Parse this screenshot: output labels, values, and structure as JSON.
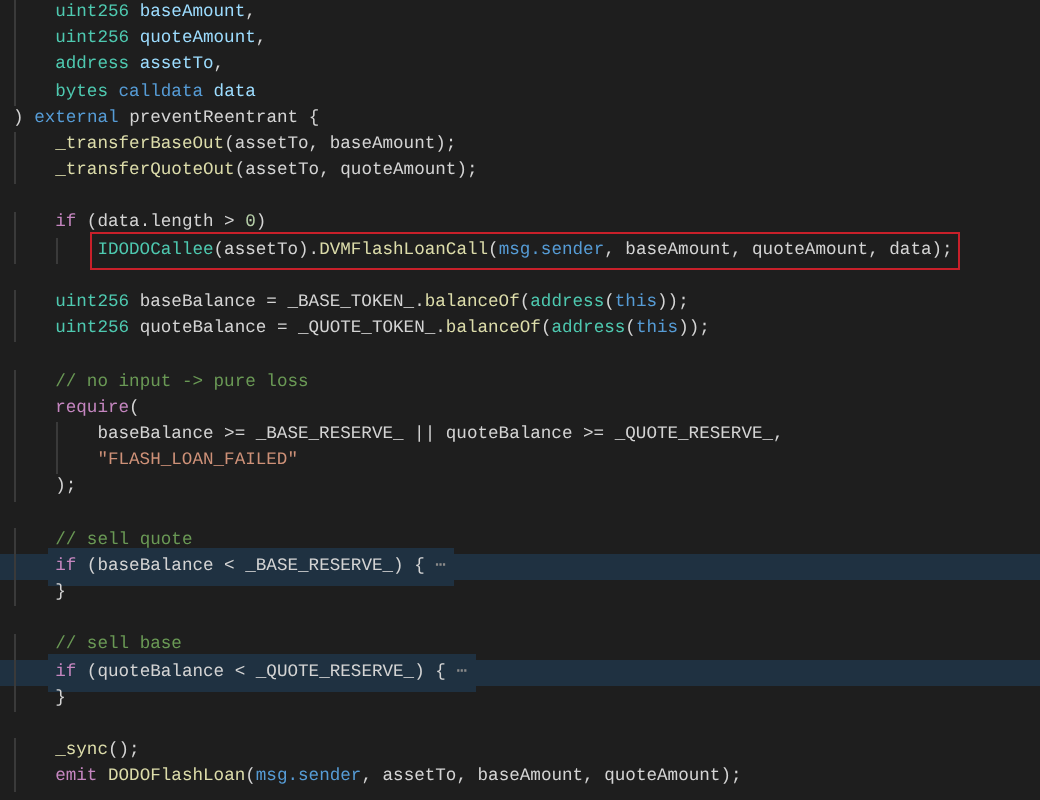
{
  "editor": {
    "lines": [
      {
        "kind": "code",
        "tokens": [
          {
            "text": "    uint256",
            "kind": "type"
          },
          {
            "text": " baseAmount",
            "kind": "var"
          },
          {
            "text": ","
          }
        ],
        "folded": false,
        "boxed": false
      },
      {
        "kind": "code",
        "tokens": [
          {
            "text": "    uint256",
            "kind": "type"
          },
          {
            "text": " quoteAmount",
            "kind": "var"
          },
          {
            "text": ","
          }
        ],
        "folded": false,
        "boxed": false
      },
      {
        "kind": "code",
        "tokens": [
          {
            "text": "    address",
            "kind": "type"
          },
          {
            "text": " assetTo",
            "kind": "var"
          },
          {
            "text": ","
          }
        ],
        "folded": false,
        "boxed": false
      },
      {
        "kind": "code",
        "tokens": [
          {
            "text": "    bytes",
            "kind": "type"
          },
          {
            "text": " calldata",
            "kind": "keyword"
          },
          {
            "text": " data",
            "kind": "var"
          }
        ],
        "folded": false,
        "boxed": false
      },
      {
        "kind": "code",
        "tokens": [
          {
            "text": ") "
          },
          {
            "text": "external",
            "kind": "keyword"
          },
          {
            "text": " preventReentrant {"
          }
        ],
        "folded": false,
        "boxed": false
      },
      {
        "kind": "code",
        "tokens": [
          {
            "text": "    _transferBaseOut",
            "kind": "func"
          },
          {
            "text": "(assetTo, baseAmount);"
          }
        ],
        "folded": false,
        "boxed": false
      },
      {
        "kind": "code",
        "tokens": [
          {
            "text": "    _transferQuoteOut",
            "kind": "func"
          },
          {
            "text": "(assetTo, quoteAmount);"
          }
        ],
        "folded": false,
        "boxed": false
      },
      {
        "kind": "blank"
      },
      {
        "kind": "code",
        "tokens": [
          {
            "text": "    if",
            "kind": "control"
          },
          {
            "text": " (data.length > "
          },
          {
            "text": "0",
            "kind": "number"
          },
          {
            "text": ")"
          }
        ],
        "folded": false,
        "boxed": false
      },
      {
        "kind": "code",
        "tokens": [
          {
            "text": "        IDODOCallee",
            "kind": "type"
          },
          {
            "text": "(assetTo)."
          },
          {
            "text": "DVMFlashLoanCall",
            "kind": "func"
          },
          {
            "text": "("
          },
          {
            "text": "msg.sender",
            "kind": "keyword"
          },
          {
            "text": ", baseAmount, quoteAmount, data);"
          }
        ],
        "folded": false,
        "boxed": true
      },
      {
        "kind": "blank"
      },
      {
        "kind": "code",
        "tokens": [
          {
            "text": "    uint256",
            "kind": "type"
          },
          {
            "text": " baseBalance = _BASE_TOKEN_."
          },
          {
            "text": "balanceOf",
            "kind": "func"
          },
          {
            "text": "("
          },
          {
            "text": "address",
            "kind": "type"
          },
          {
            "text": "("
          },
          {
            "text": "this",
            "kind": "keyword"
          },
          {
            "text": "));"
          }
        ],
        "folded": false,
        "boxed": false
      },
      {
        "kind": "code",
        "tokens": [
          {
            "text": "    uint256",
            "kind": "type"
          },
          {
            "text": " quoteBalance = _QUOTE_TOKEN_."
          },
          {
            "text": "balanceOf",
            "kind": "func"
          },
          {
            "text": "("
          },
          {
            "text": "address",
            "kind": "type"
          },
          {
            "text": "("
          },
          {
            "text": "this",
            "kind": "keyword"
          },
          {
            "text": "));"
          }
        ],
        "folded": false,
        "boxed": false
      },
      {
        "kind": "blank"
      },
      {
        "kind": "code",
        "tokens": [
          {
            "text": "    // no input -> pure loss",
            "kind": "comment"
          }
        ],
        "folded": false,
        "boxed": false
      },
      {
        "kind": "code",
        "tokens": [
          {
            "text": "    require",
            "kind": "control"
          },
          {
            "text": "("
          }
        ],
        "folded": false,
        "boxed": false
      },
      {
        "kind": "code",
        "tokens": [
          {
            "text": "        baseBalance >= _BASE_RESERVE_ || quoteBalance >= _QUOTE_RESERVE_,"
          }
        ],
        "folded": false,
        "boxed": false
      },
      {
        "kind": "code",
        "tokens": [
          {
            "text": "        \"FLASH_LOAN_FAILED\"",
            "kind": "string"
          }
        ],
        "folded": false,
        "boxed": false
      },
      {
        "kind": "code",
        "tokens": [
          {
            "text": "    );"
          }
        ],
        "folded": false,
        "boxed": false
      },
      {
        "kind": "blank"
      },
      {
        "kind": "code",
        "tokens": [
          {
            "text": "    // sell quote",
            "kind": "comment"
          }
        ],
        "folded": false,
        "boxed": false
      },
      {
        "kind": "code",
        "tokens": [
          {
            "text": "    if",
            "kind": "control"
          },
          {
            "text": " (baseBalance < _BASE_RESERVE_) { "
          },
          {
            "text": "⋯",
            "kind": "fold"
          }
        ],
        "folded": true,
        "boxed": false
      },
      {
        "kind": "code",
        "tokens": [
          {
            "text": "    }"
          }
        ],
        "folded": false,
        "boxed": false
      },
      {
        "kind": "blank"
      },
      {
        "kind": "code",
        "tokens": [
          {
            "text": "    // sell base",
            "kind": "comment"
          }
        ],
        "folded": false,
        "boxed": false
      },
      {
        "kind": "code",
        "tokens": [
          {
            "text": "    if",
            "kind": "control"
          },
          {
            "text": " (quoteBalance < _QUOTE_RESERVE_) { "
          },
          {
            "text": "⋯",
            "kind": "fold"
          }
        ],
        "folded": true,
        "boxed": false
      },
      {
        "kind": "code",
        "tokens": [
          {
            "text": "    }"
          }
        ],
        "folded": false,
        "boxed": false
      },
      {
        "kind": "blank"
      },
      {
        "kind": "code",
        "tokens": [
          {
            "text": "    _sync",
            "kind": "func"
          },
          {
            "text": "();"
          }
        ],
        "folded": false,
        "boxed": false
      },
      {
        "kind": "code",
        "tokens": [
          {
            "text": "    emit",
            "kind": "control"
          },
          {
            "text": " DODOFlashLoan",
            "kind": "func"
          },
          {
            "text": "("
          },
          {
            "text": "msg.sender",
            "kind": "keyword"
          },
          {
            "text": ", assetTo, baseAmount, quoteAmount);"
          }
        ],
        "folded": false,
        "boxed": false
      }
    ]
  }
}
